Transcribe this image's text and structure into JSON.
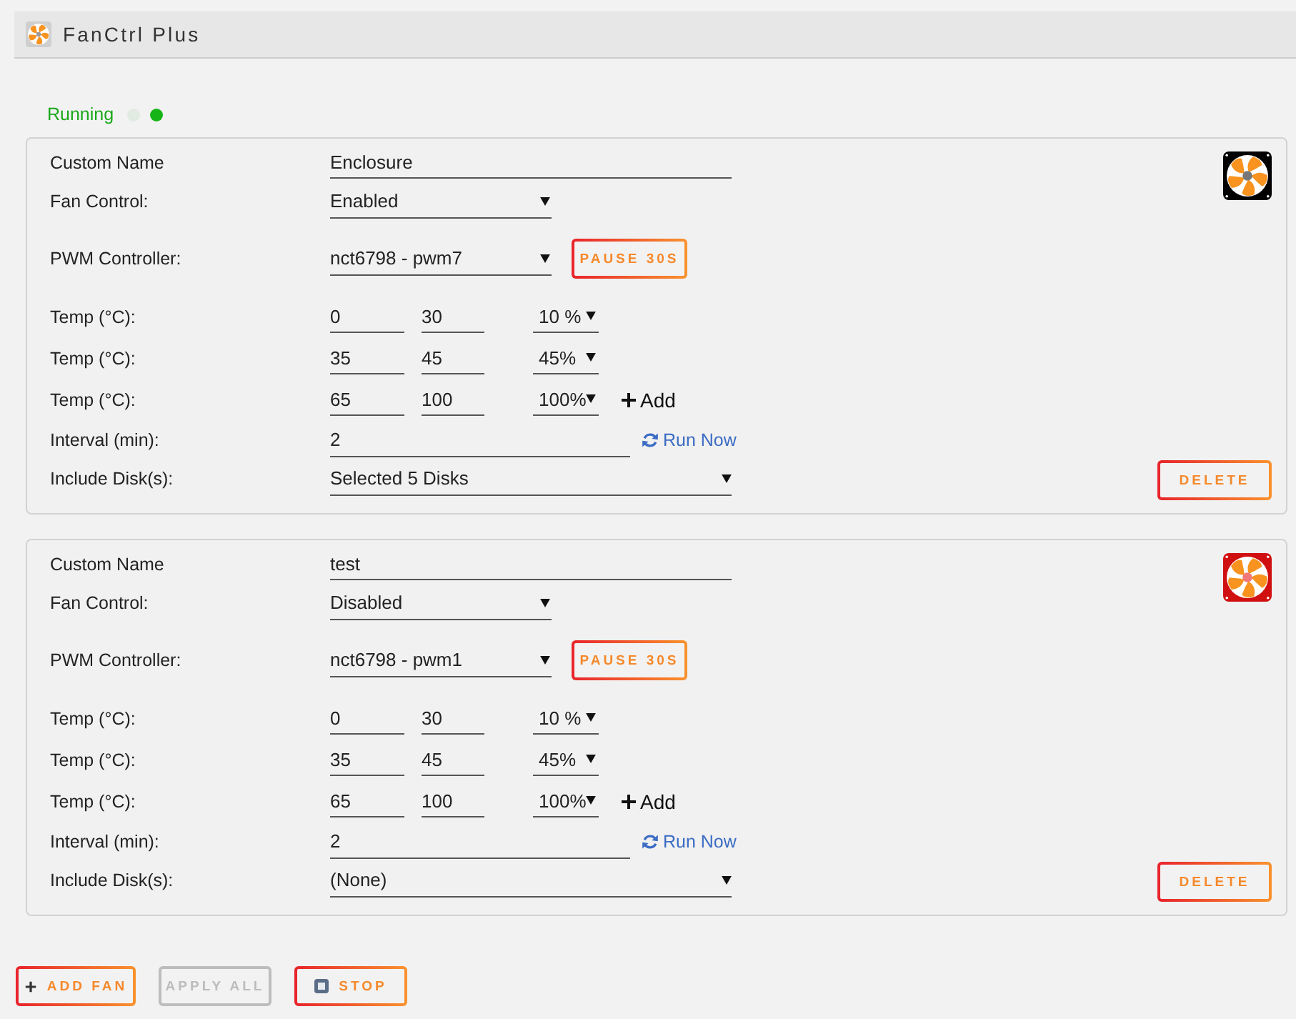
{
  "app": {
    "title": "FanCtrl Plus"
  },
  "status": {
    "text": "Running",
    "dots": [
      {
        "color": "#e1ebe1"
      },
      {
        "color": "#17b417"
      }
    ]
  },
  "fans": [
    {
      "active": true,
      "custom_name": {
        "label": "Custom Name",
        "value": "Enclosure"
      },
      "fan_control": {
        "label": "Fan Control:",
        "value": "Enabled"
      },
      "pwm_controller": {
        "label": "PWM Controller:",
        "value": "nct6798 - pwm7"
      },
      "pause_button": "PAUSE 30S",
      "temp_points": [
        {
          "label": "Temp (°C):",
          "low": "0",
          "high": "30",
          "speed": "10 %"
        },
        {
          "label": "Temp (°C):",
          "low": "35",
          "high": "45",
          "speed": "45%"
        },
        {
          "label": "Temp (°C):",
          "low": "65",
          "high": "100",
          "speed": "100%"
        }
      ],
      "add_button": "Add",
      "interval": {
        "label": "Interval (min):",
        "value": "2"
      },
      "run_now": "Run Now",
      "include_disks": {
        "label": "Include Disk(s):",
        "value": "Selected 5 Disks"
      },
      "delete_button": "DELETE"
    },
    {
      "active": false,
      "custom_name": {
        "label": "Custom Name",
        "value": "test"
      },
      "fan_control": {
        "label": "Fan Control:",
        "value": "Disabled"
      },
      "pwm_controller": {
        "label": "PWM Controller:",
        "value": "nct6798 - pwm1"
      },
      "pause_button": "PAUSE 30S",
      "temp_points": [
        {
          "label": "Temp (°C):",
          "low": "0",
          "high": "30",
          "speed": "10 %"
        },
        {
          "label": "Temp (°C):",
          "low": "35",
          "high": "45",
          "speed": "45%"
        },
        {
          "label": "Temp (°C):",
          "low": "65",
          "high": "100",
          "speed": "100%"
        }
      ],
      "add_button": "Add",
      "interval": {
        "label": "Interval (min):",
        "value": "2"
      },
      "run_now": "Run Now",
      "include_disks": {
        "label": "Include Disk(s):",
        "value": "(None)"
      },
      "delete_button": "DELETE"
    }
  ],
  "buttons": [
    {
      "label": "ADD FAN",
      "kind": "add",
      "disabled": false
    },
    {
      "label": "APPLY ALL",
      "kind": "plain",
      "disabled": true
    },
    {
      "label": "STOP",
      "kind": "stop",
      "disabled": false
    }
  ]
}
